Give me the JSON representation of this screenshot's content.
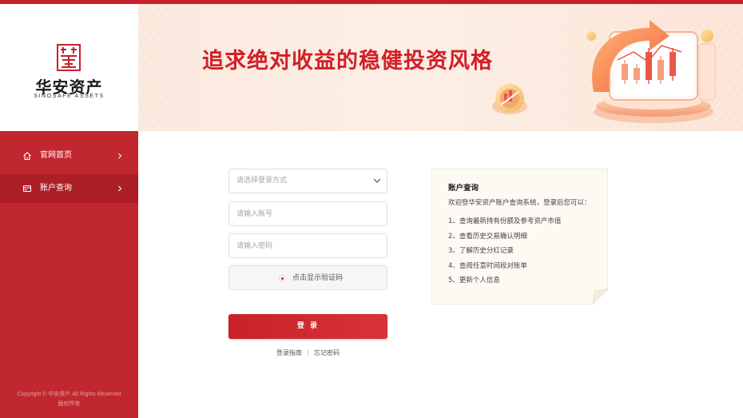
{
  "brand": {
    "name_cn": "华安资产",
    "name_en": "SINOSAFE ASSETS"
  },
  "banner": {
    "slogan": "追求绝对收益的稳健投资风格"
  },
  "sidebar": {
    "items": [
      {
        "label": "官网首页",
        "icon": "home-icon",
        "active": false
      },
      {
        "label": "账户查询",
        "icon": "card-icon",
        "active": true
      }
    ],
    "copyright_line1": "Copyright © 华安资产 All Rights Reserved",
    "copyright_line2": "版权所有"
  },
  "login_form": {
    "login_method_placeholder": "请选择登录方式",
    "account_placeholder": "请输入账号",
    "password_placeholder": "请输入密码",
    "captcha_label": "点击显示验证码",
    "submit_label": "登 录",
    "guide_link": "登录指南",
    "forgot_link": "忘记密码"
  },
  "info_card": {
    "title": "账户查询",
    "intro": "欢迎登华安资产账户查询系统，登录后您可以：",
    "items": [
      "1、查询最新持有份额及参考资产市值",
      "2、查看历史交易确认明细",
      "3、了解历史分红记录",
      "4、查阅任意时间段对账单",
      "5、更新个人信息"
    ]
  },
  "colors": {
    "brand_red": "#c8202b",
    "sidebar_red": "#c1272e",
    "sidebar_active": "#ad1f26",
    "banner_bg": "#fdeee4",
    "card_bg": "#fdfaf4"
  }
}
